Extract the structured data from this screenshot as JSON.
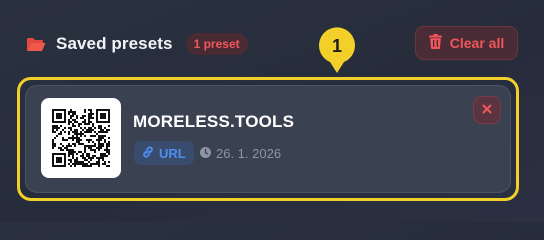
{
  "header": {
    "title": "Saved presets",
    "count_badge": "1 preset",
    "clear_label": "Clear all"
  },
  "callout": {
    "number": "1"
  },
  "presets": [
    {
      "name": "MORELESS.TOOLS",
      "type": "URL",
      "date": "26. 1. 2026"
    }
  ],
  "icons": {
    "folder": "folder-open-icon",
    "trash": "trash-icon",
    "link": "link-icon",
    "clock": "clock-icon",
    "close": "close-icon"
  },
  "colors": {
    "accent_red": "#f0565a",
    "highlight_yellow": "#f3cf2a",
    "url_blue": "#4f8ef0",
    "background": "#2a3140"
  }
}
